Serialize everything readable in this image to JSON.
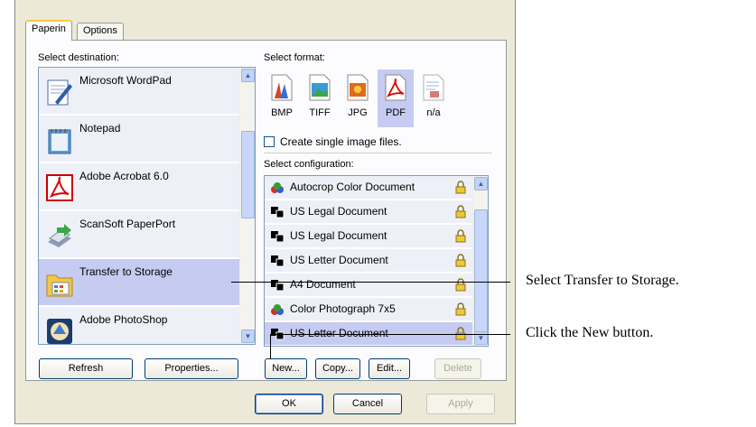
{
  "tabs": [
    {
      "label": "Paperin",
      "active": true
    },
    {
      "label": "Options",
      "active": false
    }
  ],
  "destination": {
    "label": "Select destination:",
    "items": [
      {
        "name": "Microsoft WordPad",
        "icon": "wordpad-icon",
        "selected": false
      },
      {
        "name": "Notepad",
        "icon": "notepad-icon",
        "selected": false
      },
      {
        "name": "Adobe Acrobat 6.0",
        "icon": "acrobat-icon",
        "selected": false
      },
      {
        "name": "ScanSoft PaperPort",
        "icon": "paperport-icon",
        "selected": false
      },
      {
        "name": "Transfer to Storage",
        "icon": "storage-folder-icon",
        "selected": true
      },
      {
        "name": "Adobe PhotoShop",
        "icon": "photoshop-icon",
        "selected": false
      }
    ]
  },
  "format": {
    "label": "Select format:",
    "items": [
      {
        "name": "BMP",
        "icon": "bmp-icon",
        "selected": false
      },
      {
        "name": "TIFF",
        "icon": "tiff-icon",
        "selected": false
      },
      {
        "name": "JPG",
        "icon": "jpg-icon",
        "selected": false
      },
      {
        "name": "PDF",
        "icon": "pdf-icon",
        "selected": true
      },
      {
        "name": "n/a",
        "icon": "text-format-icon",
        "selected": false
      }
    ],
    "checkbox_label": "Create single image files.",
    "checkbox_checked": false
  },
  "configuration": {
    "label": "Select configuration:",
    "items": [
      {
        "name": "Autocrop Color Document",
        "icon": "color-config-icon",
        "selected": false
      },
      {
        "name": "US Legal Document",
        "icon": "bw-config-icon",
        "selected": false
      },
      {
        "name": "US Legal Document",
        "icon": "bw-config-icon",
        "selected": false
      },
      {
        "name": "US Letter Document",
        "icon": "bw-config-icon",
        "selected": false
      },
      {
        "name": "A4 Document",
        "icon": "bw-config-icon",
        "selected": false
      },
      {
        "name": "Color Photograph 7x5",
        "icon": "color-config-icon",
        "selected": false
      },
      {
        "name": "US Letter Document",
        "icon": "bw-config-icon",
        "selected": true
      }
    ]
  },
  "buttons": {
    "refresh": "Refresh",
    "properties": "Properties...",
    "new": "New...",
    "copy": "Copy...",
    "edit": "Edit...",
    "delete": "Delete",
    "ok": "OK",
    "cancel": "Cancel",
    "apply": "Apply"
  },
  "callouts": {
    "transfer": "Select Transfer to Storage.",
    "new_button": "Click the New button."
  },
  "colors": {
    "selection": "#c6cbf1",
    "list_bg": "#eef0f8",
    "dialog_bg": "#ece9d8",
    "tab_accent": "#ffc83c"
  }
}
